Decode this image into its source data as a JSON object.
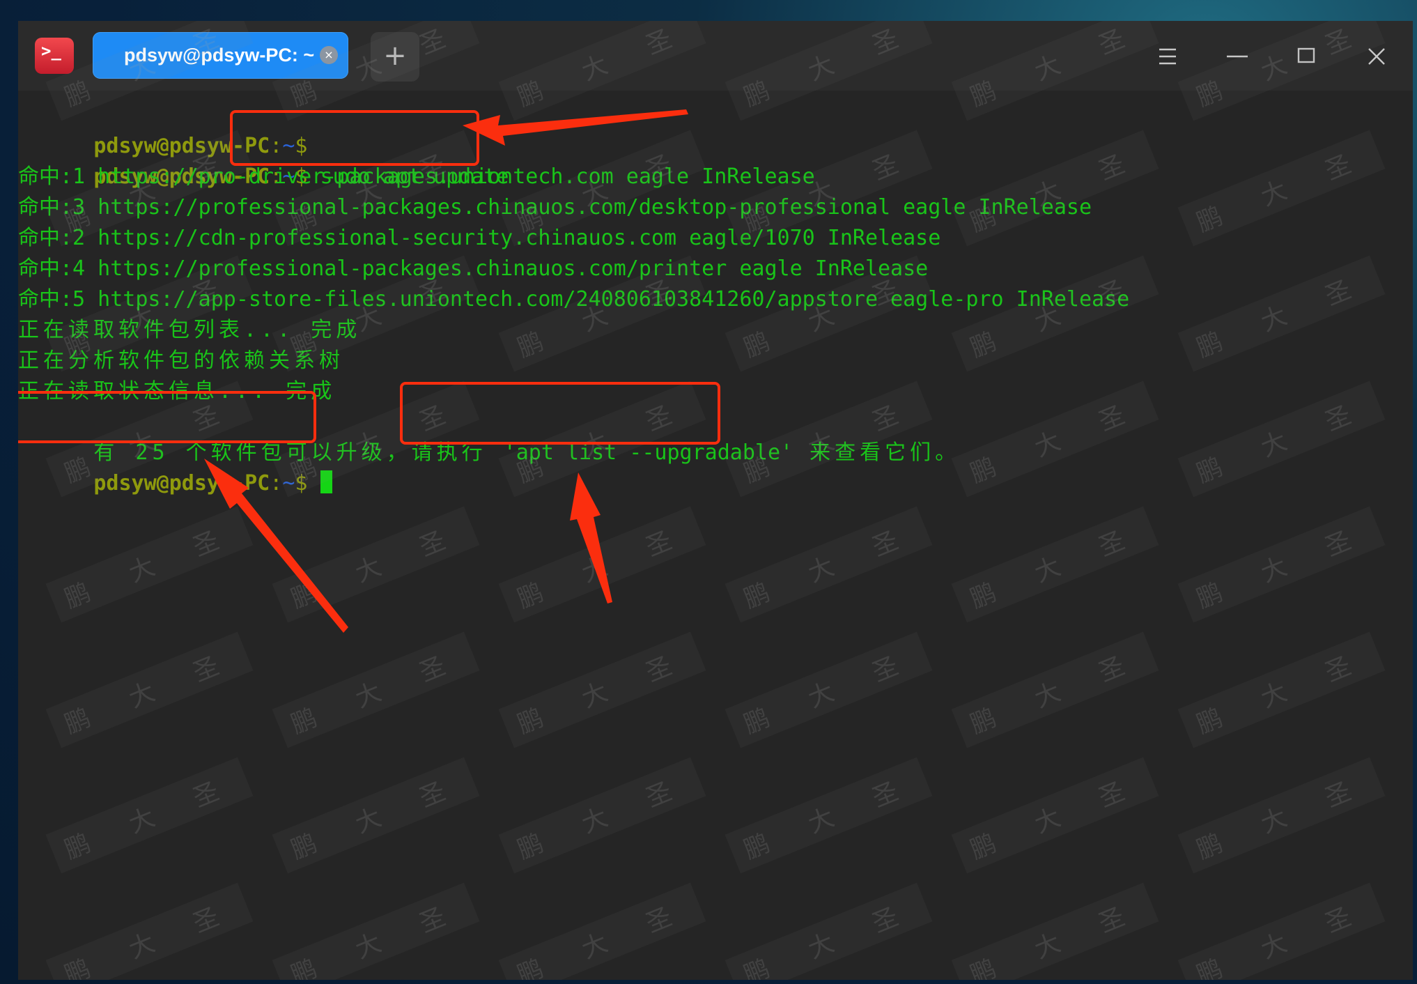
{
  "window": {
    "tab_title": "pdsyw@pdsyw-PC: ~",
    "tab_close_glyph": "×",
    "add_tab_glyph": "+",
    "app_icon_glyph": ">_"
  },
  "icons": {
    "app": "terminal-icon",
    "close_tab": "close-icon",
    "new_tab": "plus-icon",
    "menu": "hamburger-menu-icon",
    "minimize": "minimize-icon",
    "maximize": "maximize-icon",
    "close": "close-icon"
  },
  "watermark": "鹏 大 圣",
  "prompt": {
    "user_host": "pdsyw@pdsyw-PC",
    "separator": ":",
    "path": "~",
    "symbol": "$"
  },
  "terminal": {
    "command": "sudo apt update",
    "hits": [
      "命中:1 https://pro-driver-packages.uniontech.com eagle InRelease",
      "命中:3 https://professional-packages.chinauos.com/desktop-professional eagle InRelease",
      "命中:2 https://cdn-professional-security.chinauos.com eagle/1070 InRelease",
      "命中:4 https://professional-packages.chinauos.com/printer eagle InRelease",
      "命中:5 https://app-store-files.uniontech.com/240806103841260/appstore eagle-pro InRelease"
    ],
    "status_lines": [
      "正在读取软件包列表... 完成",
      "正在分析软件包的依赖关系树",
      "正在读取状态信息... 完成"
    ],
    "upgrade_notice_prefix": "有 25 个软件包可以升级",
    "upgrade_notice_mid": "，请执行 ",
    "upgrade_command": "'apt list --upgradable'",
    "upgrade_notice_suffix": " 来查看它们。"
  },
  "colors": {
    "terminal_bg": "#252525",
    "titlebar_bg": "#2b2b2b",
    "output_green": "#19c419",
    "prompt_olive": "#8f9a0d",
    "prompt_path_blue": "#2a63d9",
    "tab_blue": "#1e8bf5",
    "annotation_red": "#fb2e0e"
  }
}
